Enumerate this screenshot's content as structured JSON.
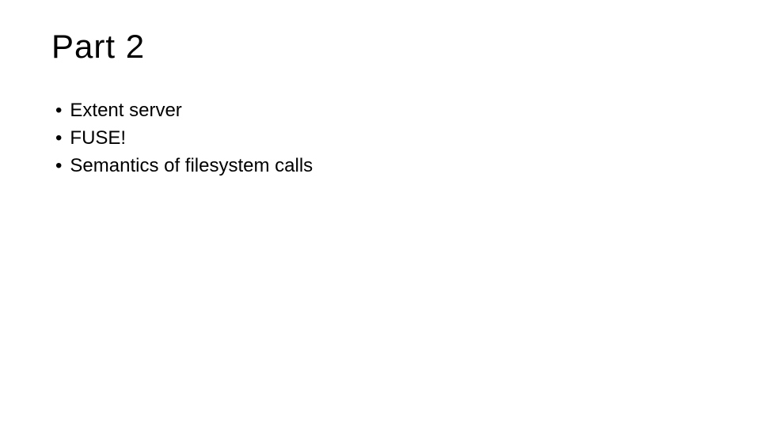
{
  "slide": {
    "title": "Part 2",
    "bullets": [
      "Extent server",
      "FUSE!",
      "Semantics of filesystem calls"
    ]
  }
}
